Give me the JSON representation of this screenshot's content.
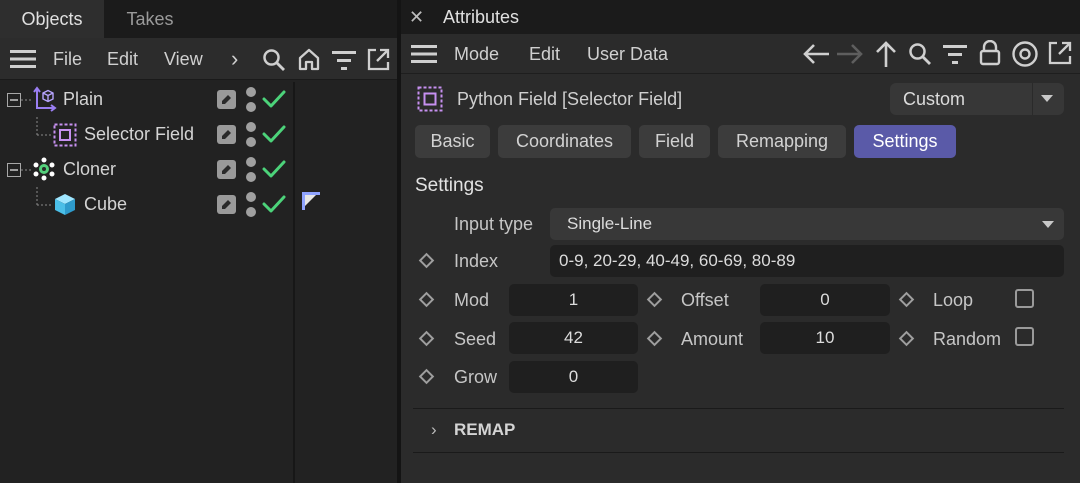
{
  "left_panel": {
    "tabs": [
      {
        "label": "Objects"
      },
      {
        "label": "Takes"
      }
    ],
    "menu": {
      "file": "File",
      "edit": "Edit",
      "view": "View",
      "more": "›"
    },
    "tree": [
      {
        "label": "Plain",
        "icon": "null-object-icon"
      },
      {
        "label": "Selector Field",
        "icon": "python-field-icon"
      },
      {
        "label": "Cloner",
        "icon": "cloner-icon"
      },
      {
        "label": "Cube",
        "icon": "cube-icon"
      }
    ]
  },
  "attributes": {
    "close": "✕",
    "title": "Attributes",
    "menu": {
      "mode": "Mode",
      "edit": "Edit",
      "user_data": "User Data"
    },
    "object_name": "Python Field [Selector Field]",
    "mode_select": "Custom",
    "tabs": [
      {
        "label": "Basic"
      },
      {
        "label": "Coordinates"
      },
      {
        "label": "Field"
      },
      {
        "label": "Remapping"
      },
      {
        "label": "Settings",
        "active": true
      }
    ],
    "section_title": "Settings",
    "input_type": {
      "label": "Input type",
      "value": "Single-Line"
    },
    "index": {
      "label": "Index",
      "value": "0-9, 20-29, 40-49, 60-69, 80-89"
    },
    "mod": {
      "label": "Mod",
      "value": "1"
    },
    "offset": {
      "label": "Offset",
      "value": "0"
    },
    "loop": {
      "label": "Loop",
      "checked": false
    },
    "seed": {
      "label": "Seed",
      "value": "42"
    },
    "amount": {
      "label": "Amount",
      "value": "10"
    },
    "random": {
      "label": "Random",
      "checked": false
    },
    "grow": {
      "label": "Grow",
      "value": "0"
    },
    "remap_group": {
      "label": "REMAP",
      "arrow": "›"
    }
  },
  "colors": {
    "accent_tab": "#5a5aa8",
    "check_green": "#4cd37a",
    "field_purple": "#c790f0",
    "cube_cyan": "#5ec8ee"
  }
}
